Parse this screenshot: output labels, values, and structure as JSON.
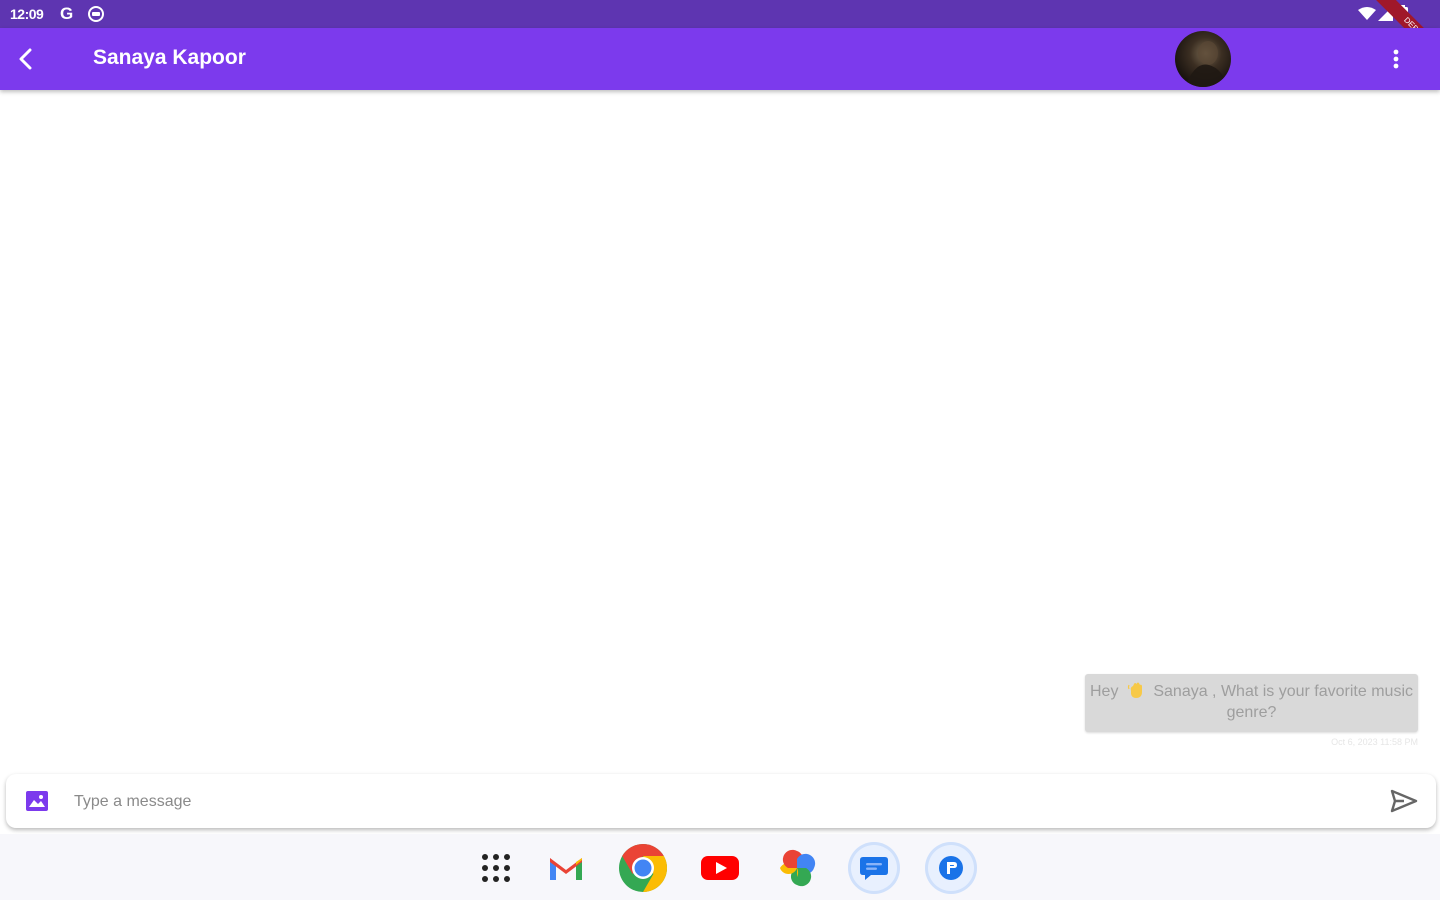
{
  "status_bar": {
    "time": "12:09",
    "left_icons": [
      "google-g-icon",
      "accessibility-icon"
    ],
    "right_icons": [
      "wifi-icon",
      "cell-signal-icon",
      "battery-icon"
    ],
    "debug_banner": "DEBUG"
  },
  "app_bar": {
    "title": "Sanaya Kapoor",
    "background": "#7c3aed",
    "icons": [
      "back-arrow-icon",
      "avatar",
      "more-vert-icon"
    ]
  },
  "messages": [
    {
      "text_before": "Hey",
      "emoji_icon": "waving-hand-icon",
      "text_after": "Sanaya , What is your favorite music genre?",
      "timestamp": "Oct 6, 2023 11:58 PM",
      "bubble_color": "#d9d9d9",
      "side": "right"
    }
  ],
  "composer": {
    "placeholder": "Type a message",
    "value": "",
    "icons": [
      "image-icon",
      "send-icon"
    ],
    "accent": "#7c3aed"
  },
  "dock": {
    "apps": [
      "app-drawer-icon",
      "gmail-icon",
      "chrome-icon",
      "youtube-icon",
      "google-photos-icon",
      "messages-icon",
      "files-icon"
    ]
  }
}
